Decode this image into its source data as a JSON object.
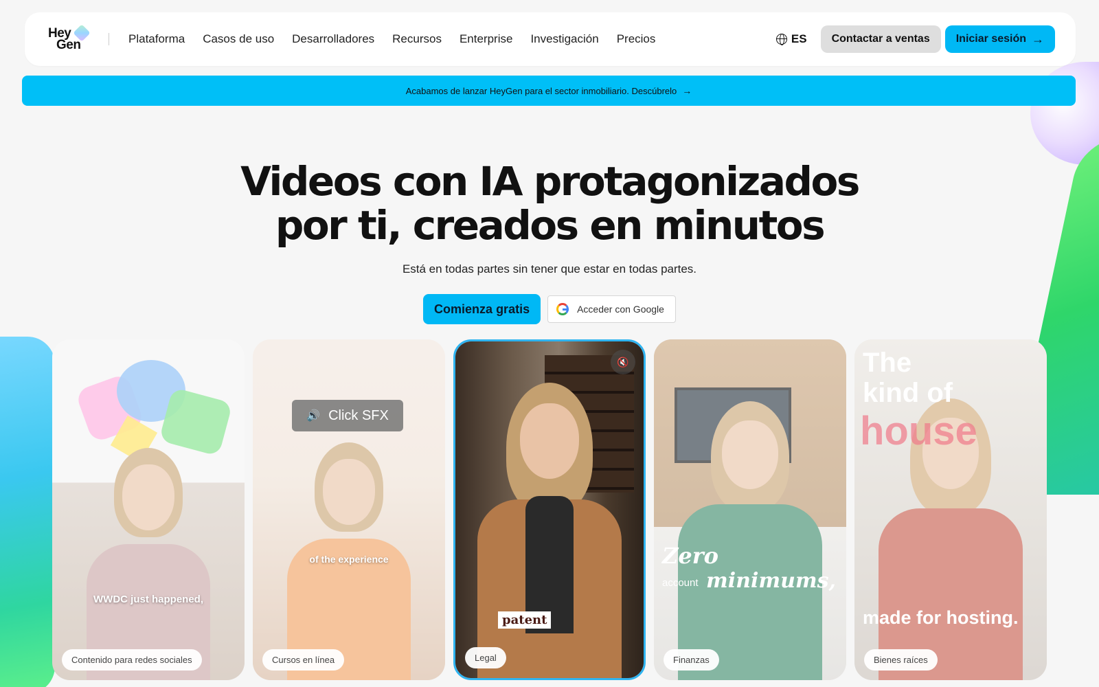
{
  "header": {
    "logo_line1": "Hey",
    "logo_line2": "Gen",
    "nav": [
      "Plataforma",
      "Casos de uso",
      "Desarrolladores",
      "Recursos",
      "Enterprise",
      "Investigación",
      "Precios"
    ],
    "language": "ES",
    "contact_sales": "Contactar a ventas",
    "login": "Iniciar sesión"
  },
  "banner": {
    "text": "Acabamos de lanzar HeyGen para el sector inmobiliario. Descúbrelo"
  },
  "hero": {
    "title_line1": "Videos con IA protagonizados",
    "title_line2": "por ti, creados en minutos",
    "subtitle": "Está en todas partes sin tener que estar en todas partes.",
    "cta_primary": "Comienza gratis",
    "cta_google": "Acceder con Google"
  },
  "cards": [
    {
      "tag": "Contenido para redes sociales",
      "caption": "WWDC just happened,"
    },
    {
      "tag": "Cursos en línea",
      "caption": "of the experience",
      "overlay": "Click SFX"
    },
    {
      "tag": "Legal",
      "caption": "patent"
    },
    {
      "tag": "Finanzas",
      "caption_1": "Zero",
      "caption_2": "account",
      "caption_3": "minimums,"
    },
    {
      "tag": "Bienes raíces",
      "caption_1": "The",
      "caption_2": "kind of",
      "caption_3": "house",
      "caption_4": "made for hosting."
    }
  ],
  "colors": {
    "accent": "#00b8f5",
    "background": "#f6f6f6",
    "text": "#111111"
  },
  "icons": [
    "globe-icon",
    "arrow-right-icon",
    "google-icon",
    "speaker-icon",
    "mute-icon"
  ]
}
